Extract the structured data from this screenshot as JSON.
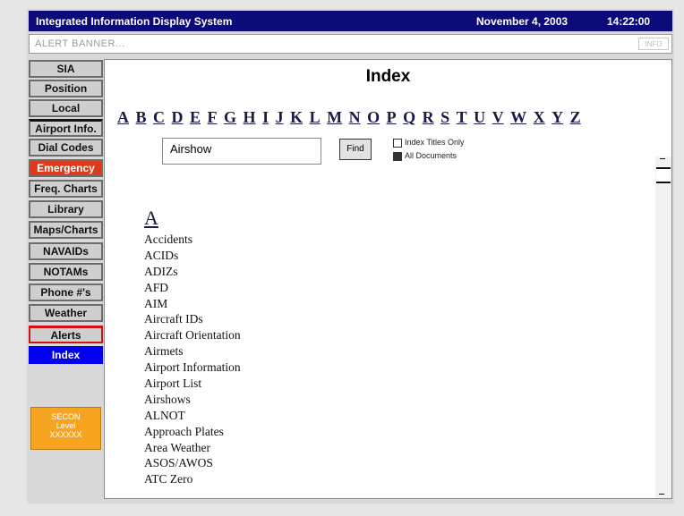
{
  "title_bar": {
    "app_title": "Integrated Information Display System",
    "date": "November 4, 2003",
    "time": "14:22:00"
  },
  "alert_banner": {
    "text": "ALERT BANNER...",
    "info_button": "INFO"
  },
  "nav": [
    {
      "label": "SIA"
    },
    {
      "label": "Position"
    },
    {
      "label": "Local"
    },
    {
      "label": "Airport Info."
    },
    {
      "label": "Dial Codes"
    },
    {
      "label": "Emergency"
    },
    {
      "label": "Freq. Charts"
    },
    {
      "label": "Library"
    },
    {
      "label": "Maps/Charts"
    },
    {
      "label": "NAVAIDs"
    },
    {
      "label": "NOTAMs"
    },
    {
      "label": "Phone #'s"
    },
    {
      "label": "Weather"
    },
    {
      "label": "Alerts"
    },
    {
      "label": "Index"
    }
  ],
  "secon": {
    "line1": "SECON",
    "line2": "Level",
    "line3": "XXXXXX"
  },
  "main": {
    "title": "Index",
    "alphabet": [
      "A",
      "B",
      "C",
      "D",
      "E",
      "F",
      "G",
      "H",
      "I",
      "J",
      "K",
      "L",
      "M",
      "N",
      "O",
      "P",
      "Q",
      "R",
      "S",
      "T",
      "U",
      "V",
      "W",
      "X",
      "Y",
      "Z"
    ],
    "search_value": "Airshow",
    "find_label": "Find",
    "option_titles": "Index Titles Only",
    "option_all": "All Documents",
    "section_letter": "A",
    "entries": [
      "Accidents",
      "ACIDs",
      "ADIZs",
      "AFD",
      "AIM",
      "Aircraft IDs",
      "Aircraft Orientation",
      "Airmets",
      "Airport Information",
      "Airport List",
      "Airshows",
      "ALNOT",
      "Approach Plates",
      "Area Weather",
      "ASOS/AWOS",
      "ATC Zero"
    ]
  }
}
